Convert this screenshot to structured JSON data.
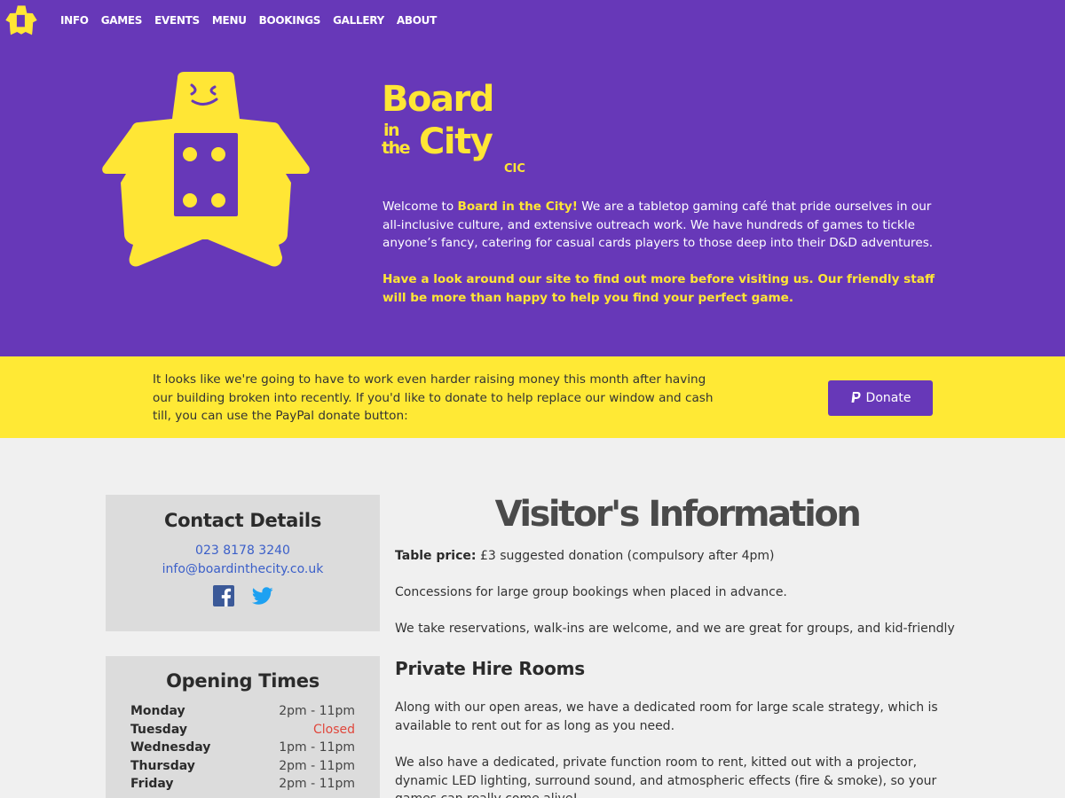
{
  "brand": {
    "colors": {
      "purple": "#6738b8",
      "yellow": "#ffe935",
      "link": "#3b5fc9",
      "closed": "#e0473c"
    },
    "wordmark": {
      "line1": "Board",
      "line2a": "in",
      "line2b": "the",
      "line3": "City",
      "suffix": "CIC"
    }
  },
  "nav": {
    "items": [
      "INFO",
      "GAMES",
      "EVENTS",
      "MENU",
      "BOOKINGS",
      "GALLERY",
      "ABOUT"
    ]
  },
  "hero": {
    "welcome_prefix": "Welcome to ",
    "welcome_name": "Board in the City!",
    "welcome_rest": " We are a tabletop gaming café that pride ourselves in our all-inclusive culture, and extensive outreach work. We have hundreds of games to tickle anyone’s fancy, catering for casual cards players to those deep into their D&D adventures.",
    "cta": "Have a look around our site to find out more before visiting us. Our friendly staff will be more than happy to help you find your perfect game."
  },
  "donate": {
    "text": "It looks like we're going to have to work even harder raising money this month after having our building broken into recently. If you'd like to donate to help replace our window and cash till, you can use the PayPal donate button:",
    "button_label": "Donate",
    "icon": "paypal-icon"
  },
  "contact": {
    "heading": "Contact Details",
    "phone": "023 8178 3240",
    "email": "info@boardinthecity.co.uk",
    "social": [
      "facebook-icon",
      "twitter-icon"
    ]
  },
  "hours": {
    "heading": "Opening Times",
    "rows": [
      {
        "day": "Monday",
        "time": "2pm - 11pm"
      },
      {
        "day": "Tuesday",
        "time": "Closed"
      },
      {
        "day": "Wednesday",
        "time": "1pm - 11pm"
      },
      {
        "day": "Thursday",
        "time": "2pm - 11pm"
      },
      {
        "day": "Friday",
        "time": "2pm - 11pm"
      }
    ]
  },
  "visitor": {
    "title": "Visitor's Information",
    "table_label": "Table price:",
    "table_value": " £3 suggested donation (compulsory after 4pm)",
    "concessions": "Concessions for large group bookings when placed in advance.",
    "reservations": "We take reservations, walk-ins are welcome, and we are great for groups, and kid-friendly",
    "private_heading": "Private Hire Rooms",
    "private_p1": "Along with our open areas, we have a dedicated room for large scale strategy, which is available to rent out for as long as you need.",
    "private_p2": "We also have a dedicated, private function room to rent, kitted out with a projector, dynamic LED lighting, surround sound, and atmospheric effects (fire & smoke), so your games can really come alive!"
  }
}
